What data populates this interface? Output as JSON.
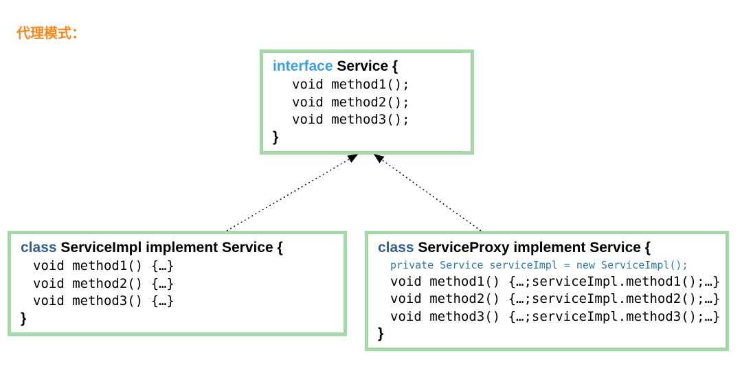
{
  "title": "代理模式：",
  "interfaceBox": {
    "keyword": "interface",
    "name": "Service {",
    "lines": [
      "void method1();",
      "void method2();",
      "void method3();"
    ],
    "close": "}"
  },
  "implBox": {
    "keyword": "class",
    "name": "ServiceImpl implement Service {",
    "lines": [
      "void method1() {…}",
      "void method2() {…}",
      "void method3() {…}"
    ],
    "close": "}"
  },
  "proxyBox": {
    "keyword": "class",
    "name": "ServiceProxy implement Service {",
    "privateLine": "private Service serviceImpl = new ServiceImpl();",
    "lines": [
      "void method1() {…;serviceImpl.method1();…}",
      "void method2() {…;serviceImpl.method2();…}",
      "void method3() {…;serviceImpl.method3();…}"
    ],
    "close": "}"
  }
}
